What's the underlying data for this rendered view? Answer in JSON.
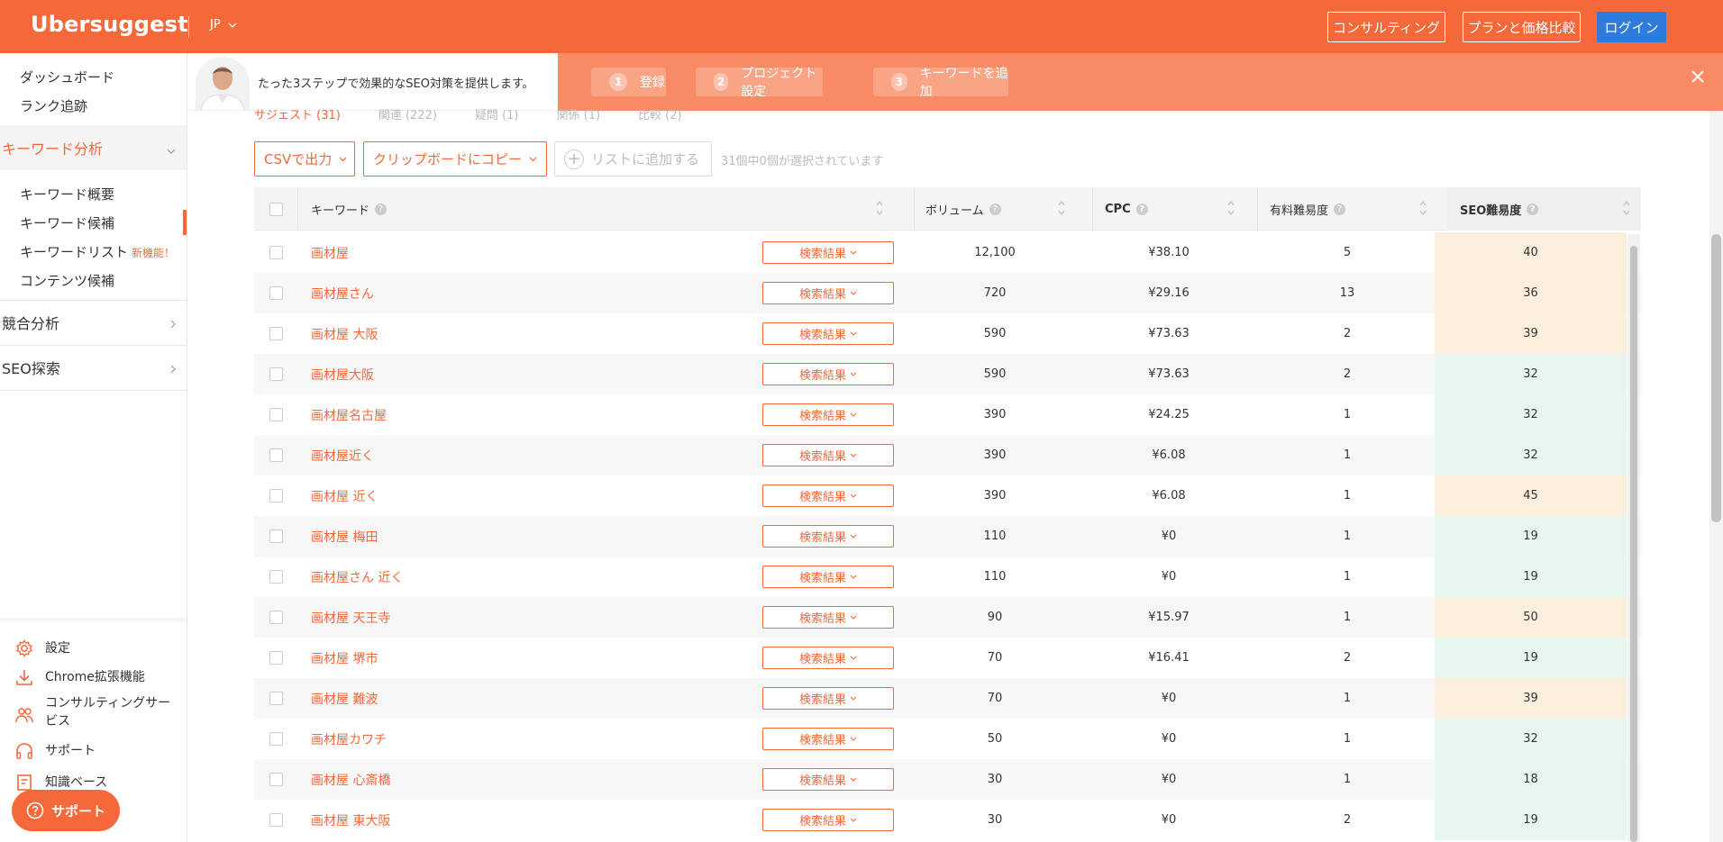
{
  "app": {
    "logo": "Ubersuggest",
    "lang": "JP"
  },
  "topbar": {
    "consulting": "コンサルティング",
    "pricing": "プランと価格比較",
    "login": "ログイン"
  },
  "sidebar": {
    "dashboard": "ダッシュボード",
    "rank_tracking": "ランク追跡",
    "keyword_analysis": "キーワード分析",
    "kw_items": [
      "キーワード概要",
      "キーワード候補",
      "キーワードリスト",
      "コンテンツ候補"
    ],
    "new_badge": "新機能！",
    "competitor": "競合分析",
    "seo_explore": "SEO探索",
    "bottom": [
      "設定",
      "Chrome拡張機能",
      "コンサルティングサービス",
      "サポート",
      "知識ベース"
    ],
    "support_pill": "サポート"
  },
  "banner": {
    "text": "たった3ステップで効果的なSEO対策を提供します。",
    "steps": [
      {
        "num": "1",
        "label": "登録"
      },
      {
        "num": "2",
        "label": "プロジェクト設定"
      },
      {
        "num": "3",
        "label": "キーワードを追加"
      }
    ]
  },
  "tabs": [
    "サジェスト (31)",
    "関連 (222)",
    "疑問 (1)",
    "関係 (1)",
    "比較 (2)"
  ],
  "actions": {
    "csv": "CSVで出力",
    "clipboard": "クリップボードにコピー",
    "add_list": "リストに追加する",
    "selected": "31個中0個が選択されています"
  },
  "table": {
    "headers": {
      "keyword": "キーワード",
      "volume": "ボリューム",
      "cpc": "CPC",
      "paid": "有料難易度",
      "seo": "SEO難易度"
    },
    "serp_label": "検索結果",
    "rows": [
      {
        "kw": "画材屋",
        "vol": "12,100",
        "cpc": "¥38.10",
        "paid": "5",
        "seo": "40"
      },
      {
        "kw": "画材屋さん",
        "vol": "720",
        "cpc": "¥29.16",
        "paid": "13",
        "seo": "36"
      },
      {
        "kw": "画材屋 大阪",
        "vol": "590",
        "cpc": "¥73.63",
        "paid": "2",
        "seo": "39"
      },
      {
        "kw": "画材屋大阪",
        "vol": "590",
        "cpc": "¥73.63",
        "paid": "2",
        "seo": "32"
      },
      {
        "kw": "画材屋名古屋",
        "vol": "390",
        "cpc": "¥24.25",
        "paid": "1",
        "seo": "32"
      },
      {
        "kw": "画材屋近く",
        "vol": "390",
        "cpc": "¥6.08",
        "paid": "1",
        "seo": "32"
      },
      {
        "kw": "画材屋 近く",
        "vol": "390",
        "cpc": "¥6.08",
        "paid": "1",
        "seo": "45"
      },
      {
        "kw": "画材屋 梅田",
        "vol": "110",
        "cpc": "¥0",
        "paid": "1",
        "seo": "19"
      },
      {
        "kw": "画材屋さん 近く",
        "vol": "110",
        "cpc": "¥0",
        "paid": "1",
        "seo": "19"
      },
      {
        "kw": "画材屋 天王寺",
        "vol": "90",
        "cpc": "¥15.97",
        "paid": "1",
        "seo": "50"
      },
      {
        "kw": "画材屋 堺市",
        "vol": "70",
        "cpc": "¥16.41",
        "paid": "2",
        "seo": "19"
      },
      {
        "kw": "画材屋 難波",
        "vol": "70",
        "cpc": "¥0",
        "paid": "1",
        "seo": "39"
      },
      {
        "kw": "画材屋カワチ",
        "vol": "50",
        "cpc": "¥0",
        "paid": "1",
        "seo": "32"
      },
      {
        "kw": "画材屋 心斎橋",
        "vol": "30",
        "cpc": "¥0",
        "paid": "1",
        "seo": "18"
      },
      {
        "kw": "画材屋 東大阪",
        "vol": "30",
        "cpc": "¥0",
        "paid": "2",
        "seo": "19"
      }
    ]
  },
  "colors": {
    "accent": "#f4683a",
    "seo_easy": "#e6f6ef",
    "seo_medium": "#fbeedc",
    "login_blue": "#2e7bdc"
  }
}
